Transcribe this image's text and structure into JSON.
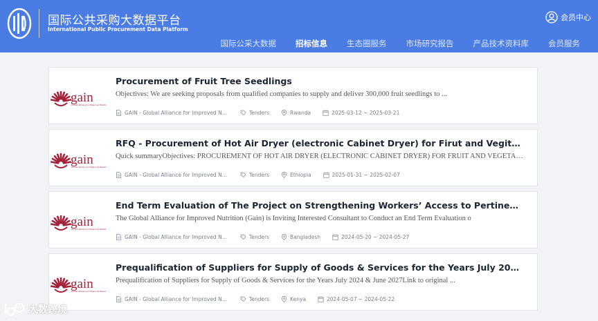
{
  "header": {
    "brand_title": "国际公共采购大数据平台",
    "brand_subtitle": "International Public Procurement Data Platform",
    "user_label": "会员中心",
    "nav": [
      "国际公采大数据",
      "招标信息",
      "生态圈服务",
      "市场研究报告",
      "产品技术资料库",
      "会员服务"
    ],
    "active_nav": "招标信息",
    "colors": {
      "bar": "#4a7ce3",
      "text": "#ffffff"
    }
  },
  "tenders": [
    {
      "title": "Procurement of Fruit Tree Seedlings",
      "description": "Objectives: We are seeking proposals from qualified companies to supply and deliver 300,000 fruit seedlings to ...",
      "org": "GAIN - Global Alliance for Improved Nutrition",
      "type": "Tenders",
      "country": "Rwanda",
      "dates": "2025-03-12 ~ 2025-03-21"
    },
    {
      "title": "RFQ - Procurement of Hot Air Dryer (electronic Cabinet Dryer) for Firut and Vegitable Drying Au...",
      "description": "Quick summaryObjectives: PROCUREMENT OF HOT AIR DRYER (ELECTRONIC CABINET DRYER) FOR FRUIT AND VEGETABLE DR...",
      "org": "GAIN - Global Alliance for Improved Nutrition",
      "type": "Tenders",
      "country": "Ethiopia",
      "dates": "2025-01-31 ~ 2025-02-07"
    },
    {
      "title": "End Term Evaluation of The Project on Strengthening Workers’ Access to Pertinent Nutri...",
      "description": "The Global Alliance for Improved Nutrition (Gain) is Inviting Interested Consultant to Conduct an End Term Evaluation o",
      "org": "GAIN - Global Alliance for Improved Nutrition",
      "type": "Tenders",
      "country": "Bangladesh",
      "dates": "2024-05-20 ~ 2024-05-27"
    },
    {
      "title": "Prequalification of Suppliers for Supply of Goods & Services for the Years July 2024 ...",
      "description": "Prequalification of Suppliers for Supply of Goods & Services for the Years July 2024 & June 2027Link to original ...",
      "org": "GAIN - Global Alliance for Improved Nutrition",
      "type": "Tenders",
      "country": "Kenya",
      "dates": "2024-05-07 ~ 2024-05-22"
    }
  ],
  "logo_text": {
    "word": "gain",
    "tagline": "Global Alliance for Improved Nutrition",
    "color": "#a3223a"
  },
  "watermark": "大数跨境"
}
